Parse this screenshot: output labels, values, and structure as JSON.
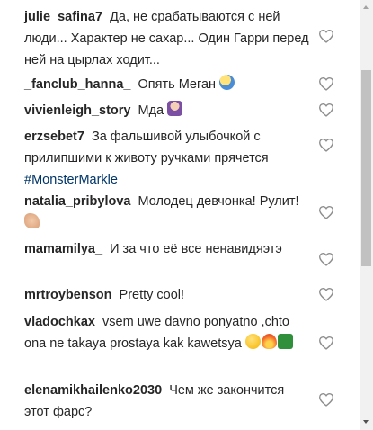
{
  "comments": [
    {
      "user": "julie_safina7",
      "text": "Да, не срабатываются с ней люди... Характер не сахар... Один Гарри перед ней на цырлах ходит..."
    },
    {
      "user": "_fanclub_hanna_",
      "text": "Опять Меган",
      "emojis": [
        "face-screaming-in-fear"
      ]
    },
    {
      "user": "vivienleigh_story",
      "text": "Мда",
      "emojis": [
        "person-facepalming"
      ]
    },
    {
      "user": "erzsebet7",
      "text": "За фальшивой улыбочкой с прилипшими к животу ручками прячется",
      "hashtag": "#MonsterMarkle"
    },
    {
      "user": "natalia_pribylova",
      "text": "Молодец девчонка! Рулит!",
      "emojis": [
        "flexed-biceps"
      ]
    },
    {
      "user": "mamamilya_",
      "text": "И за что её все ненавидяэтэ"
    },
    {
      "user": "mrtroybenson",
      "text": "Pretty cool!"
    },
    {
      "user": "vladochkax",
      "text": "vsem uwe davno ponyatno ,chto ona ne takaya prostaya kak kawetsya",
      "emojis": [
        "face-with-tears-of-joy",
        "fire",
        "pretzel-green"
      ]
    },
    {
      "user": "elenamikhailenko2030",
      "text": "Чем же закончится этот фарс?"
    }
  ],
  "like_icon": "heart-outline-icon",
  "colors": {
    "username": "#262626",
    "hashtag": "#003569",
    "scrollbar_thumb": "#c1c1c1"
  }
}
